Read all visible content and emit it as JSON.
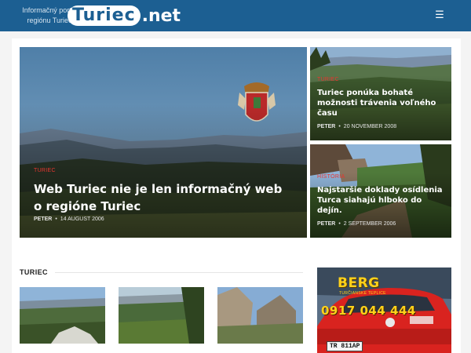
{
  "header": {
    "tagline": "Informačný portál regiónu Turiec",
    "logo_main": "Turiec",
    "logo_suffix": ".net",
    "menu_icon": "hamburger-icon",
    "bg_color": "#1c5f92"
  },
  "featured": {
    "main": {
      "category": "TURIEC",
      "title": "Web Turiec nie je len informačný web o regióne Turiec",
      "author": "PETER",
      "date": "14 AUGUST 2006"
    },
    "side": [
      {
        "category": "TURIEC",
        "title": "Turiec ponúka bohaté možnosti trávenia voľného času",
        "author": "PETER",
        "date": "20 NOVEMBER 2008"
      },
      {
        "category": "HISTÓRIA",
        "title": "Najstaršie doklady osídlenia Turca siahajú hlboko do dejín.",
        "author": "PETER",
        "date": "2 SEPTEMBER 2006"
      }
    ],
    "category_color": "#e8352f"
  },
  "section": {
    "title": "TURIEC"
  },
  "ad": {
    "brand": "BERG",
    "sub": "TURČIANSKE TEPLICE",
    "phone": "0917 044 444",
    "plate": "TR 811AP",
    "taxi_color": "#d9231f"
  }
}
